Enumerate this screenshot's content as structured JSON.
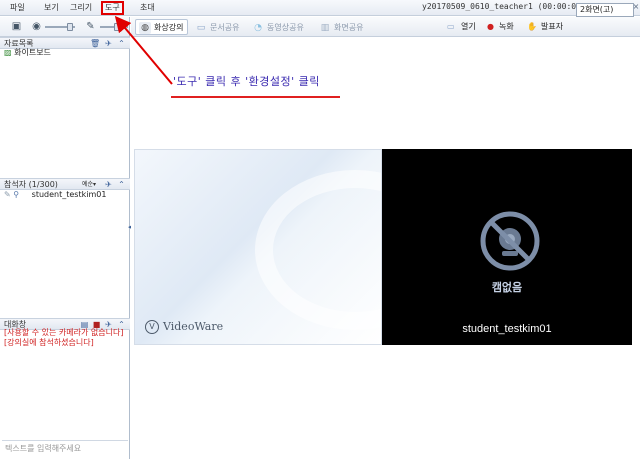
{
  "menu": {
    "file": "파일",
    "view": "보기",
    "draw": "그리기",
    "tools": "도구",
    "invite": "초대"
  },
  "window": {
    "title": "y20170509_0610_teacher1 (00:00:09)"
  },
  "panels": {
    "materials": {
      "title": "자료목록",
      "items": [
        "화이트보드"
      ]
    },
    "participants": {
      "title": "참석자 (1/300)",
      "sort_label": "예순▾",
      "items": [
        "student_testkim01"
      ]
    },
    "chat": {
      "title": "대화창",
      "messages": [
        "[사용할 수 있는 카메라가 없습니다]",
        "[강의실에 참석하셨습니다]"
      ],
      "input_placeholder": "텍스트를 입력해주세요"
    }
  },
  "tabs": [
    {
      "label": "화상강의",
      "icon": "video-lecture-icon",
      "active": true
    },
    {
      "label": "문서공유",
      "icon": "document-share-icon",
      "active": false
    },
    {
      "label": "동영상공유",
      "icon": "video-share-icon",
      "active": false
    },
    {
      "label": "화면공유",
      "icon": "screen-share-icon",
      "active": false
    }
  ],
  "toolbar_right": {
    "open": "열기",
    "record": "녹화",
    "presenter": "발표자",
    "screen_layout": "2화면(고)"
  },
  "annotation": {
    "text": "'도구' 클릭 후 '환경설정' 클릭",
    "color": "#3a2ab0",
    "highlight_color": "#e00000"
  },
  "video": {
    "brand": "VideoWare",
    "no_camera_label": "캠없음",
    "username": "student_testkim01"
  }
}
